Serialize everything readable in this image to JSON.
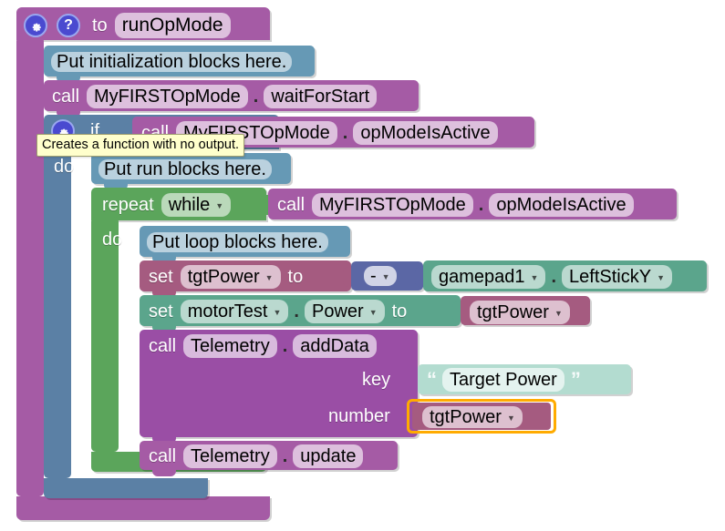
{
  "app": {
    "kind": "blockly-visual-programming-canvas",
    "tooltip": "Creates a function with no output."
  },
  "colors": {
    "procedure_purple": "#a55ba5",
    "procedure_purple_dark": "#8e4a8e",
    "control_blue": "#5b80a5",
    "control_blue_dark": "#4c6c8c",
    "loop_green": "#5ba55b",
    "loop_green_dark": "#4c8c4c",
    "comment_blue": "#6699b5",
    "call_purple": "#a55ba5",
    "variable_set_rose": "#a55b80",
    "variable_get_rose": "#a55b80",
    "actuator_green": "#5ba58c",
    "gamepad_green": "#5ba58c",
    "math_indigo": "#5b67a5",
    "text_mint": "#5ba58c",
    "icon_blue": "#4a4ad0",
    "selection_orange": "#ffab00",
    "tooltip_bg": "#ffffcc"
  },
  "blocks": {
    "procedure_def": {
      "gear_icon": "gear-icon",
      "help_icon": "question-mark-icon",
      "to_label": "to",
      "name": "runOpMode"
    },
    "init_comment": {
      "text": "Put initialization blocks here."
    },
    "call_wait_for_start": {
      "call_label": "call",
      "object": "MyFIRSTOpMode",
      "dot": ".",
      "method": "waitForStart"
    },
    "if_block": {
      "gear_icon": "gear-icon",
      "if_label": "if",
      "do_label": "do",
      "condition": {
        "call_label": "call",
        "object": "MyFIRSTOpMode",
        "dot": ".",
        "method": "opModeIsActive"
      }
    },
    "run_comment": {
      "text": "Put run blocks here."
    },
    "repeat_block": {
      "repeat_label": "repeat",
      "mode": "while",
      "do_label": "do",
      "condition": {
        "call_label": "call",
        "object": "MyFIRSTOpMode",
        "dot": ".",
        "method": "opModeIsActive"
      }
    },
    "loop_comment": {
      "text": "Put loop blocks here."
    },
    "set_tgtpower": {
      "set_label": "set",
      "variable": "tgtPower",
      "to_label": "to",
      "negate_op": "-",
      "gamepad": "gamepad1",
      "dot": ".",
      "property": "LeftStickY"
    },
    "set_motor_power": {
      "set_label": "set",
      "device": "motorTest",
      "dot": ".",
      "property": "Power",
      "to_label": "to",
      "value": "tgtPower"
    },
    "telemetry_add_data": {
      "call_label": "call",
      "object": "Telemetry",
      "dot": ".",
      "method": "addData",
      "key_label": "key",
      "key_open_quote": "“",
      "key_value": "Target Power",
      "key_close_quote": "”",
      "number_label": "number",
      "number_value": "tgtPower",
      "number_selected": true
    },
    "telemetry_update": {
      "call_label": "call",
      "object": "Telemetry",
      "dot": ".",
      "method": "update"
    }
  }
}
